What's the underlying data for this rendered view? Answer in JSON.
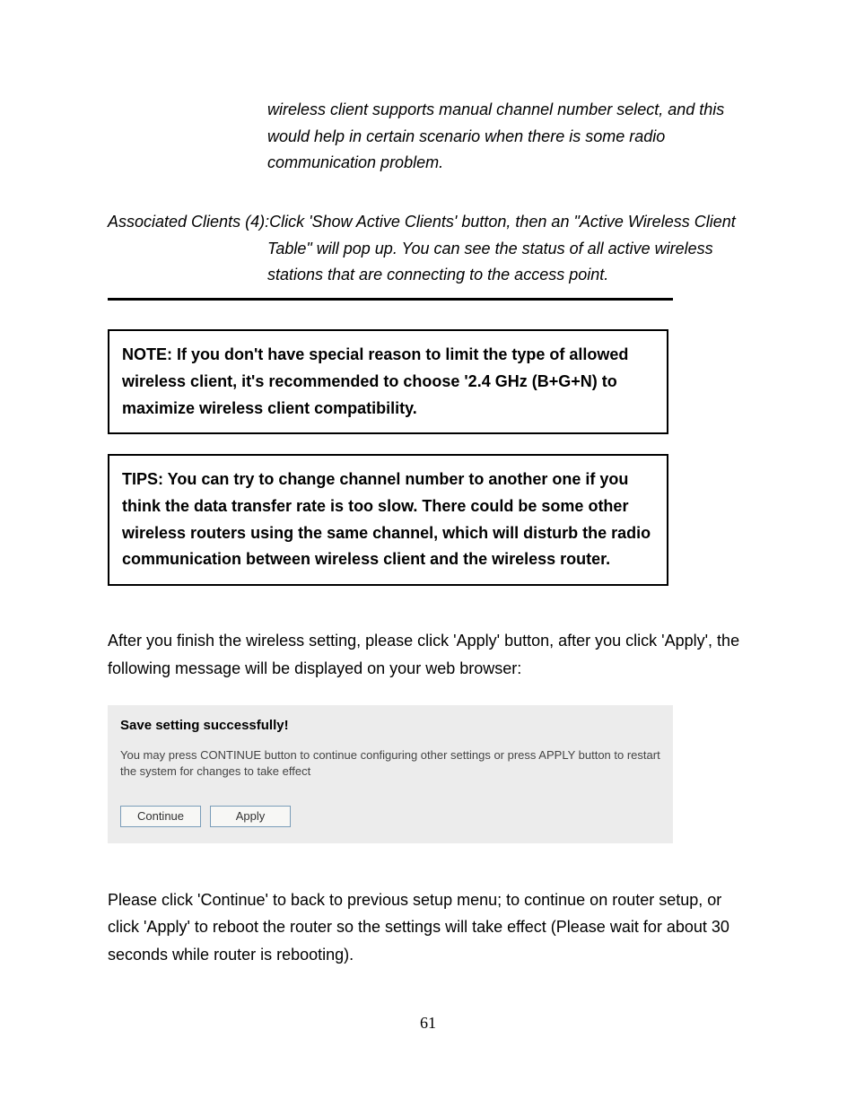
{
  "channelNote": "wireless client supports manual channel number select, and this would help in certain scenario when there is some radio communication problem.",
  "assocClients": {
    "label": "Associated Clients (4): ",
    "firstLine": "Click 'Show Active Clients' button, then an \"Active Wireless Client",
    "rest": "Table\" will pop up. You can see the status of all active wireless stations that are connecting to the access point."
  },
  "noteBox": "NOTE: If you don't have special reason to limit the type of allowed wireless client, it's recommended to choose '2.4 GHz (B+G+N) to maximize wireless client compatibility.",
  "tipsBox": "TIPS: You can try to change channel number to another one if you think the data transfer rate is too slow. There could be some other wireless routers using the same channel, which will disturb the radio communication between wireless client and the wireless router.",
  "afterText": "After you finish the wireless setting, please click 'Apply' button, after you click 'Apply', the following message will be displayed on your web browser:",
  "panel": {
    "title": "Save setting successfully!",
    "message": "You may press CONTINUE button to continue configuring other settings or press APPLY button to restart the system for changes to take effect",
    "continueBtn": "Continue",
    "applyBtn": "Apply"
  },
  "closingText": "Please click 'Continue' to back to previous setup menu; to continue on router setup, or click 'Apply' to reboot the router so the settings will take effect (Please wait for about 30 seconds while router is rebooting).",
  "pageNumber": "61"
}
